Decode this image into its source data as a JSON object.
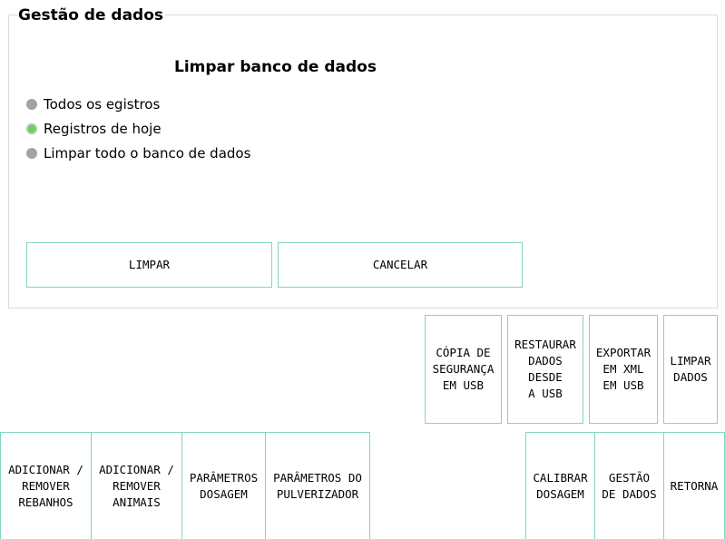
{
  "colors": {
    "accent_border": "#7fd6c2",
    "radio_off": "#a3a3a3",
    "radio_on": "#5ed94e"
  },
  "panel": {
    "title": "Gestão de dados",
    "heading": "Limpar banco de dados",
    "options": [
      {
        "label": "Todos os egistros",
        "selected": false
      },
      {
        "label": "Registros de hoje",
        "selected": true
      },
      {
        "label": "Limpar todo o banco de dados",
        "selected": false
      }
    ],
    "buttons": {
      "clear": "LIMPAR",
      "cancel": "CANCELAR"
    }
  },
  "data_menu": [
    {
      "label": "CÓPIA DE\nSEGURANÇA\nEM USB"
    },
    {
      "label": "RESTAURAR\nDADOS\nDESDE\nA USB"
    },
    {
      "label": "EXPORTAR\nEM XML\nEM USB"
    },
    {
      "label": "LIMPAR\nDADOS"
    }
  ],
  "main_menu": [
    {
      "label": "ADICIONAR /\nREMOVER\nREBANHOS"
    },
    {
      "label": "ADICIONAR /\nREMOVER\nANIMAIS"
    },
    {
      "label": "PARÂMETROS\nDOSAGEM"
    },
    {
      "label": "PARÂMETROS DO\nPULVERIZADOR"
    },
    {
      "label": "CALIBRAR\nDOSAGEM"
    },
    {
      "label": "GESTÃO\nDE DADOS"
    },
    {
      "label": "RETORNA"
    }
  ]
}
